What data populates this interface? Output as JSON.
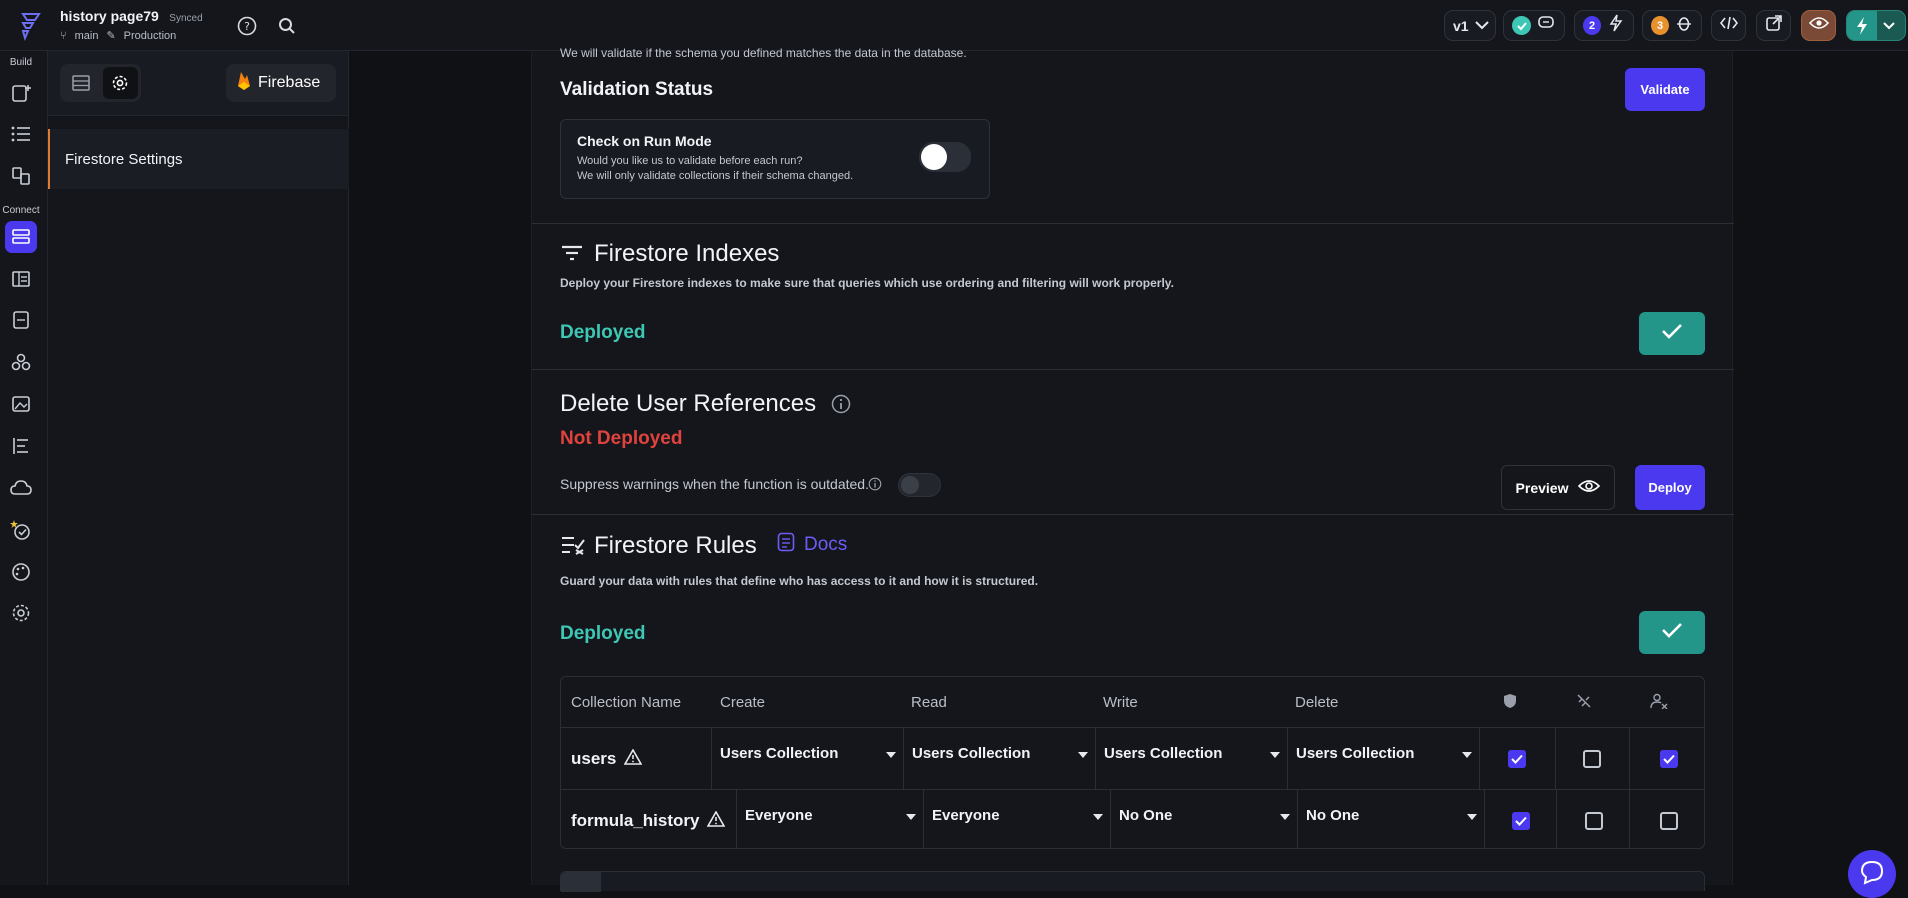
{
  "header": {
    "project_title": "history page79",
    "sync_status": "Synced",
    "branch": "main",
    "environment": "Production",
    "version": "v1",
    "badge_two": "2",
    "badge_three": "3"
  },
  "rail": {
    "build_label": "Build",
    "connect_label": "Connect"
  },
  "panel": {
    "brand": "Firebase",
    "active_item": "Firestore Settings"
  },
  "validation": {
    "top_note": "We will validate if the schema you defined matches the data in the database.",
    "title": "Validation Status",
    "validate_label": "Validate",
    "card_title": "Check on Run Mode",
    "card_line1": "Would you like us to validate before each run?",
    "card_line2": "We will only validate collections if their schema changed."
  },
  "indexes": {
    "title": "Firestore Indexes",
    "description": "Deploy your Firestore indexes to make sure that queries which use ordering and filtering will work properly.",
    "status": "Deployed"
  },
  "delete_refs": {
    "title": "Delete User References",
    "status": "Not Deployed",
    "suppress_text": "Suppress warnings when the function is outdated.",
    "preview_label": "Preview",
    "deploy_label": "Deploy"
  },
  "rules": {
    "title": "Firestore Rules",
    "docs_label": "Docs",
    "description": "Guard your data with rules that define who has access to it and how it is structured.",
    "status": "Deployed",
    "columns": {
      "name": "Collection Name",
      "create": "Create",
      "read": "Read",
      "write": "Write",
      "delete": "Delete"
    },
    "rows": [
      {
        "name": "users",
        "create": "Users Collection",
        "read": "Users Collection",
        "write": "Users Collection",
        "delete": "Users Collection"
      },
      {
        "name": "formula_history",
        "create": "Everyone",
        "read": "Everyone",
        "write": "No One",
        "delete": "No One"
      }
    ]
  }
}
